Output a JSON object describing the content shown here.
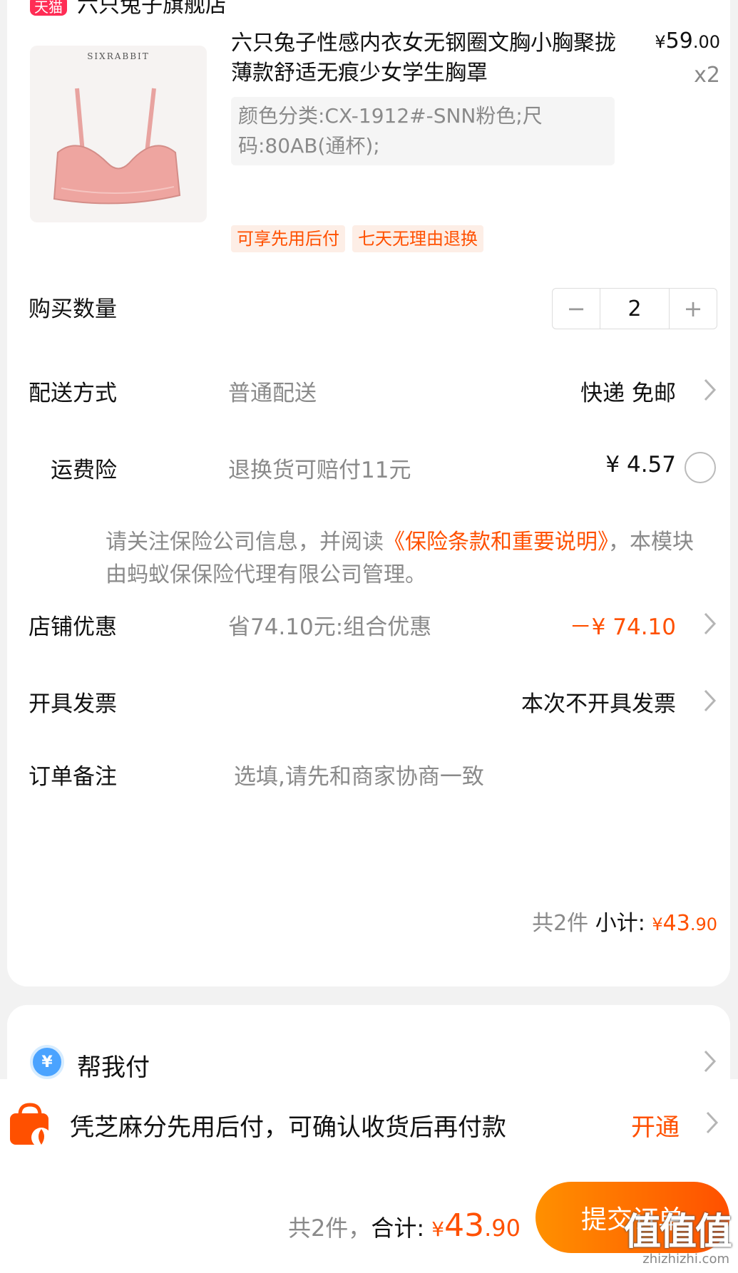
{
  "shop": {
    "badge": "天猫",
    "name": "六只兔子旗舰店"
  },
  "product": {
    "brand": "SIXRABBIT",
    "title": "六只兔子性感内衣女无钢圈文胸小胸聚拢薄款舒适无痕少女学生胸罩",
    "price_currency": "¥",
    "price_int": "59",
    "price_dec": ".00",
    "quantity": "x2",
    "spec": "颜色分类:CX-1912#-SNN粉色;尺码:80AB(通杯);",
    "tags": [
      "可享先用后付",
      "七天无理由退换"
    ]
  },
  "quantity_row": {
    "label": "购买数量",
    "value": "2",
    "minus": "−",
    "plus": "+"
  },
  "delivery_row": {
    "label": "配送方式",
    "sub": "普通配送",
    "value": "快递 免邮"
  },
  "insurance_row": {
    "label": "运费险",
    "sub": "退换货可赔付11元",
    "value": "¥ 4.57"
  },
  "insurance_notice": {
    "prefix": "请关注保险公司信息，并阅读",
    "link": "《保险条款和重要说明》",
    "suffix": "，本模块由蚂蚁保保险代理有限公司管理。"
  },
  "discount_row": {
    "label": "店铺优惠",
    "sub": "省74.10元:组合优惠",
    "value": "－¥ 74.10"
  },
  "invoice_row": {
    "label": "开具发票",
    "value": "本次不开具发票"
  },
  "note_row": {
    "label": "订单备注",
    "placeholder": "选填,请先和商家协商一致"
  },
  "subtotal": {
    "count": "共2件",
    "label": " 小计: ",
    "currency": "¥",
    "int": "43",
    "dec": ".90"
  },
  "help_pay": {
    "icon": "¥",
    "label": "帮我付"
  },
  "credit": {
    "text": "凭芝麻分先用后付，可确认收货后再付款",
    "action": "开通"
  },
  "footer": {
    "count": "共2件，",
    "label": "合计: ",
    "currency": "¥",
    "int": "43",
    "dec": ".90",
    "submit": "提交订单"
  },
  "watermark": {
    "logo": "值值值",
    "site": "zhizhizhi.com"
  },
  "colors": {
    "accent": "#ff5000",
    "tag_bg": "#fdeee6",
    "help_blue": "#4aa3ff",
    "badge_red": "#ff2d55"
  }
}
